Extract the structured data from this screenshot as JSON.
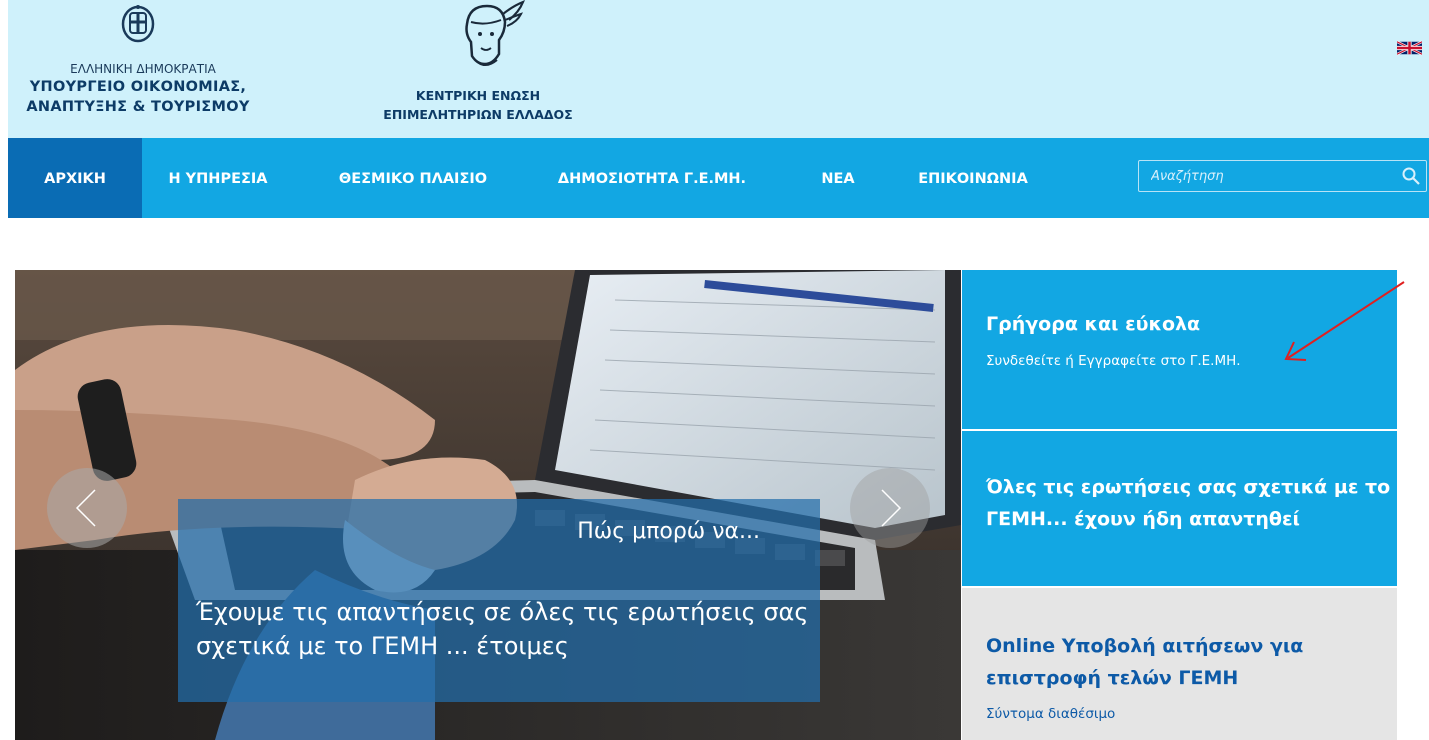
{
  "header": {
    "ministry": {
      "line1": "ΕΛΛΗΝΙΚΗ ΔΗΜΟΚΡΑΤΙΑ",
      "line2": "ΥΠΟΥΡΓΕΙΟ ΟΙΚΟΝΟΜΙΑΣ,",
      "line3": "ΑΝΑΠΤΥΞΗΣ & ΤΟΥΡΙΣΜΟΥ",
      "icon": "greek-emblem-icon"
    },
    "chamber": {
      "line1": "ΚΕΝΤΡΙΚΗ ΕΝΩΣΗ",
      "line2": "ΕΠΙΜΕΛΗΤΗΡΙΩΝ ΕΛΛΑΔΟΣ",
      "icon": "hermes-logo-icon"
    },
    "language_icon": "uk-flag-icon"
  },
  "nav": {
    "items": [
      {
        "label": "ΑΡΧΙΚΗ",
        "active": true
      },
      {
        "label": "Η ΥΠΗΡΕΣΙΑ",
        "active": false
      },
      {
        "label": "ΘΕΣΜΙΚΟ ΠΛΑΙΣΙΟ",
        "active": false
      },
      {
        "label": "ΔΗΜΟΣΙΟΤΗΤΑ Γ.Ε.ΜΗ.",
        "active": false
      },
      {
        "label": "ΝΕΑ",
        "active": false
      },
      {
        "label": "ΕΠΙΚΟΙΝΩΝΙΑ",
        "active": false
      }
    ],
    "search": {
      "placeholder": "Αναζήτηση",
      "value": ""
    }
  },
  "hero": {
    "subtitle": "Πώς μπορώ να...",
    "caption": "Έχουμε τις απαντήσεις σε όλες τις ερωτήσεις σας σχετικά με το ΓΕΜΗ ... έτοιμες"
  },
  "panels": [
    {
      "title": "Γρήγορα και εύκολα",
      "subtitle": "Συνδεθείτε ή Εγγραφείτε στο Γ.Ε.ΜΗ."
    },
    {
      "title": "Όλες τις ερωτήσεις σας σχετικά με το ΓΕΜΗ... έχουν ήδη απαντηθεί"
    },
    {
      "title": "Online Υποβολή αιτήσεων για επιστροφή τελών ΓΕΜΗ",
      "subtitle": "Σύντομα διαθέσιμο"
    }
  ],
  "colors": {
    "header_bg": "#cff1fb",
    "nav_bg": "#12a7e3",
    "nav_active": "#0a6cb4",
    "panel_blue": "#12a7e3",
    "panel_grey": "#e5e5e5",
    "dark_blue_text": "#0d5aa7"
  }
}
